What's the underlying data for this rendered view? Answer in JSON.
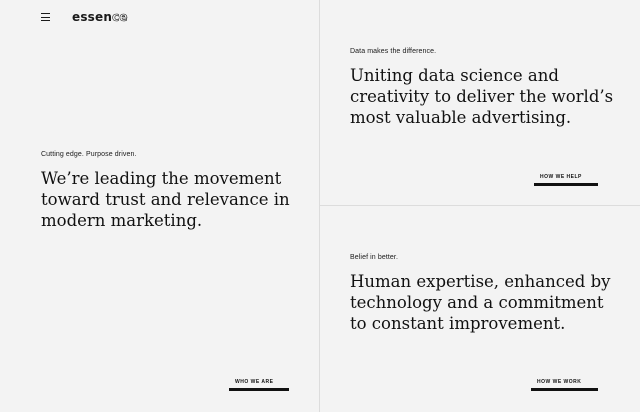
{
  "header": {
    "logo_solid": "essen",
    "logo_outline": "ce"
  },
  "panel_left": {
    "eyebrow": "Cutting edge. Purpose driven.",
    "headline_lines": [
      "We’re leading the movement",
      "toward trust and relevance in",
      "modern marketing."
    ],
    "cta": "WHO WE ARE"
  },
  "panel_top_right": {
    "eyebrow": "Data makes the difference.",
    "headline_lines": [
      "Uniting data science and",
      "creativity to deliver the world’s",
      "most valuable advertising."
    ],
    "cta": "HOW WE HELP"
  },
  "panel_bottom_right": {
    "eyebrow": "Belief in better.",
    "headline_lines": [
      "Human expertise, enhanced by",
      "technology and a commitment",
      "to constant improvement."
    ],
    "cta": "HOW WE WORK"
  }
}
